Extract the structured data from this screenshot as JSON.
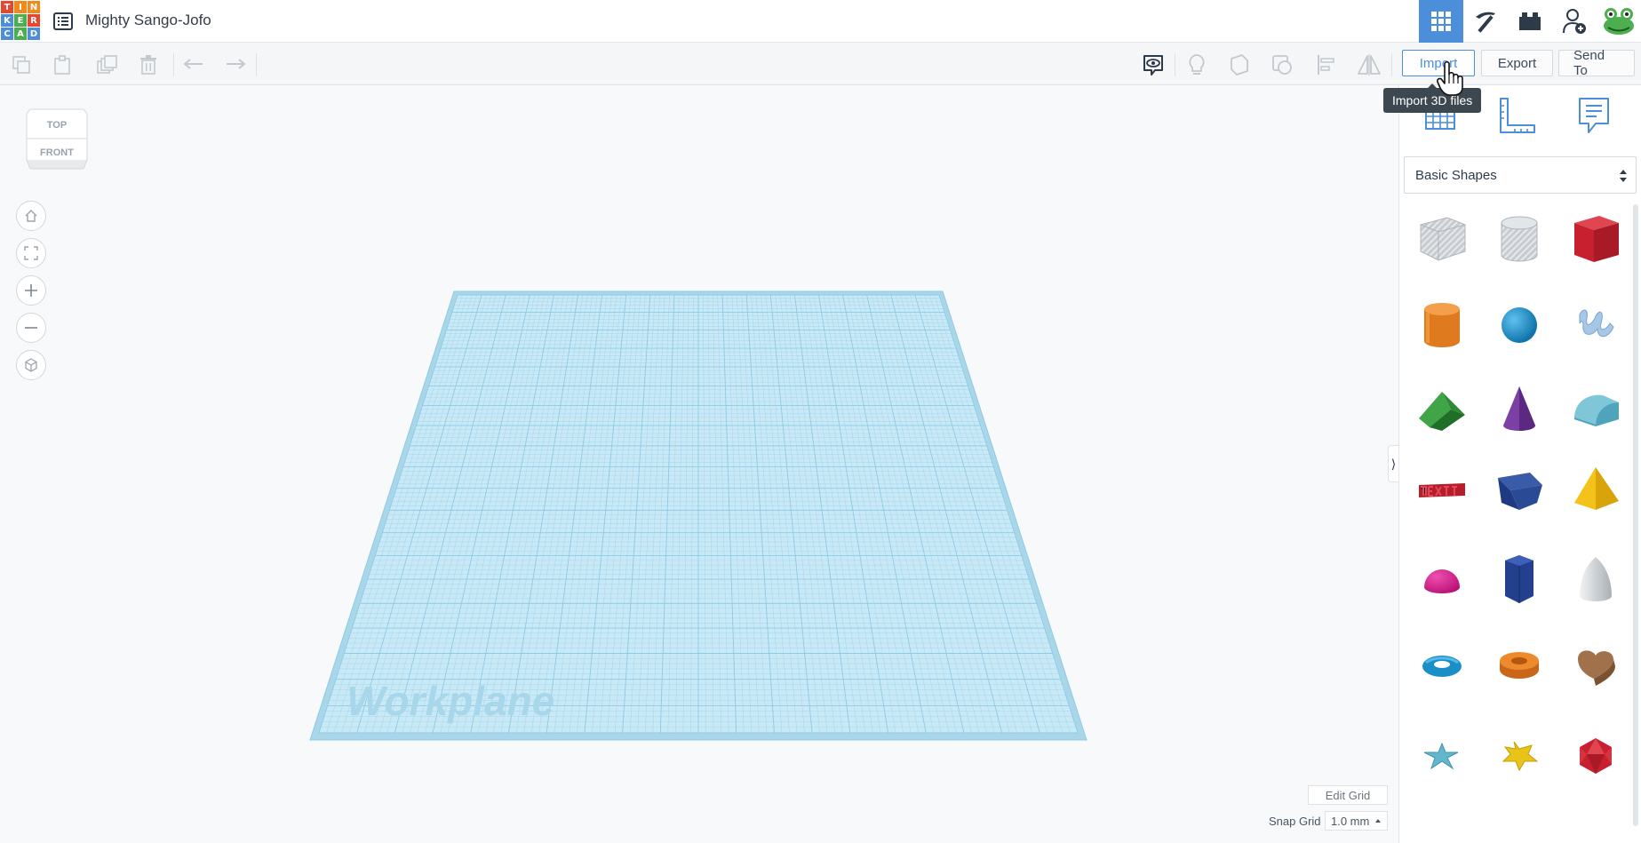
{
  "logo": {
    "letters": [
      "T",
      "I",
      "N",
      "K",
      "E",
      "R",
      "C",
      "A",
      "D"
    ]
  },
  "design": {
    "title": "Mighty Sango-Jofo"
  },
  "toolbar": {
    "import_label": "Import",
    "export_label": "Export",
    "send_to_label": "Send To",
    "tooltip_text": "Import 3D files"
  },
  "viewcube": {
    "top_label": "TOP",
    "front_label": "FRONT"
  },
  "workplane": {
    "label": "Workplane"
  },
  "grid": {
    "edit_label": "Edit Grid",
    "snap_label": "Snap Grid",
    "snap_value": "1.0 mm"
  },
  "panel": {
    "category_value": "Basic Shapes",
    "shapes": [
      "box-hole",
      "cylinder-hole",
      "box",
      "cylinder",
      "sphere",
      "scribble",
      "roof",
      "cone",
      "round-roof",
      "text",
      "wedge",
      "pyramid",
      "half-sphere",
      "polygon",
      "paraboloid",
      "torus",
      "tube",
      "heart",
      "star",
      "star-six-point",
      "icosahedron"
    ]
  },
  "colors": {
    "accent": "#4c8ed9",
    "workplane": "#bfe3f2",
    "grid_line": "#8ccbe6"
  }
}
